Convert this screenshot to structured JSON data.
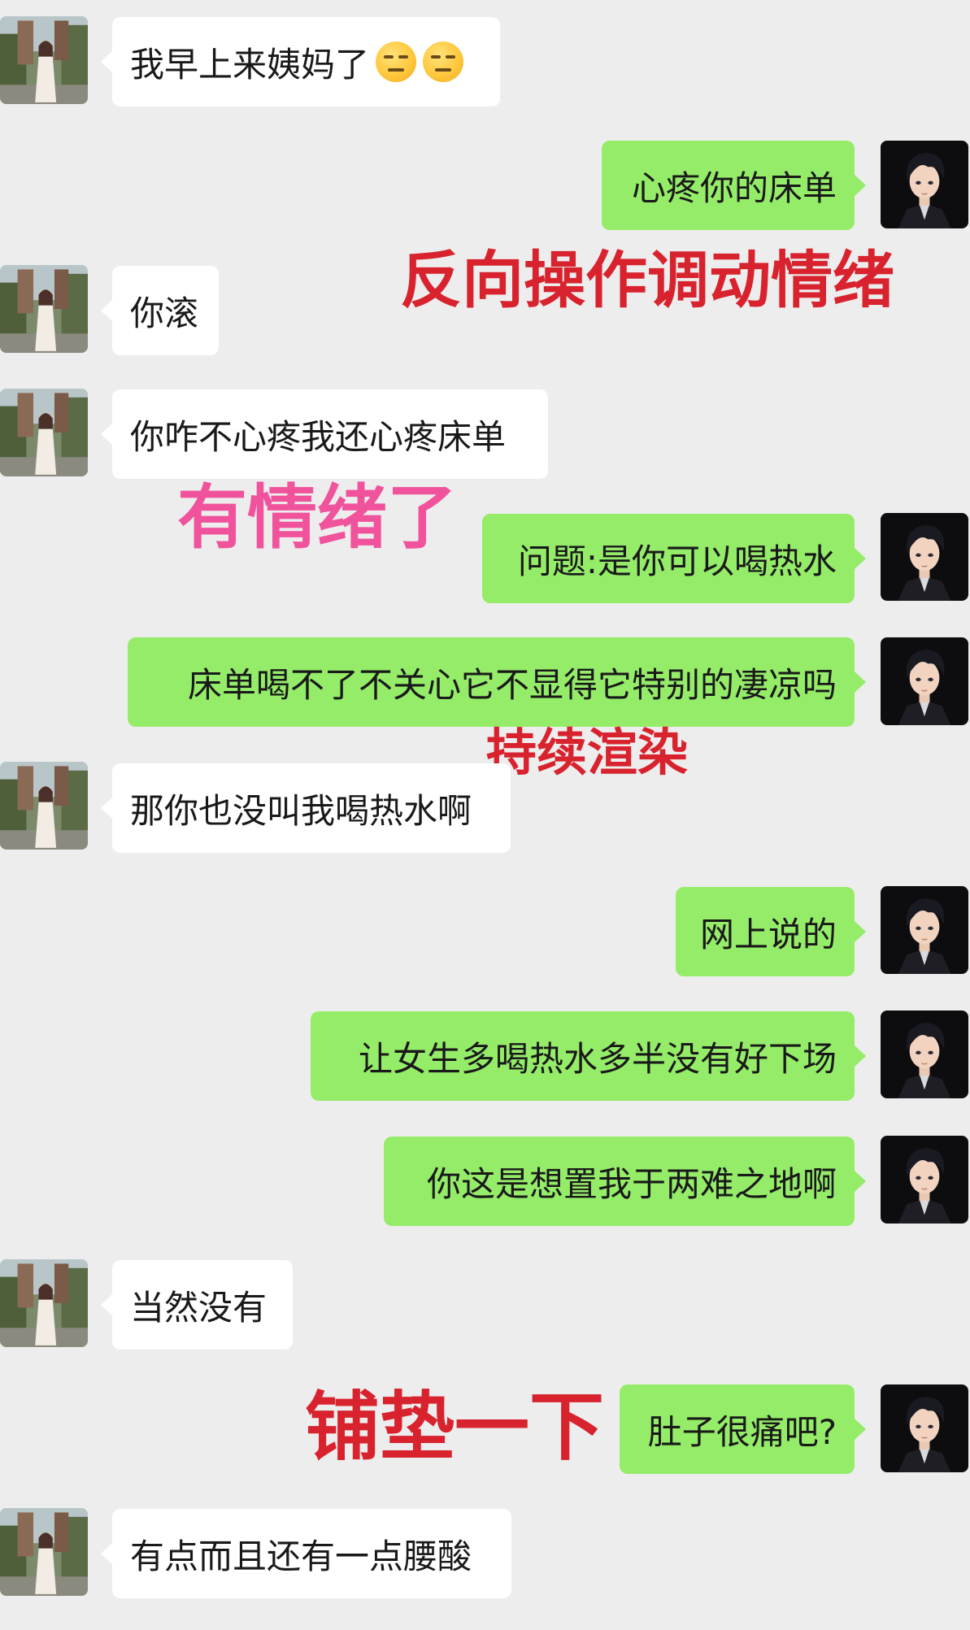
{
  "colors": {
    "background": "#ededed",
    "incoming_bubble": "#ffffff",
    "outgoing_bubble": "#95ec69",
    "annotation_red": "#d8232e",
    "annotation_pink": "#f0539c"
  },
  "avatars": {
    "incoming": "woman-in-garden-photo",
    "outgoing": "anime-dark-haired-man-portrait"
  },
  "messages": [
    {
      "side": "in",
      "text": "我早上来姨妈了",
      "emojis": [
        "expressionless-face-icon",
        "expressionless-face-icon"
      ]
    },
    {
      "side": "out",
      "text": "心疼你的床单"
    },
    {
      "side": "in",
      "text": "你滚"
    },
    {
      "side": "in",
      "text": "你咋不心疼我还心疼床单"
    },
    {
      "side": "out",
      "text": "问题:是你可以喝热水"
    },
    {
      "side": "out",
      "text": "床单喝不了不关心它不显得它特别的凄凉吗"
    },
    {
      "side": "in",
      "text": "那你也没叫我喝热水啊"
    },
    {
      "side": "out",
      "text": "网上说的"
    },
    {
      "side": "out",
      "text": "让女生多喝热水多半没有好下场"
    },
    {
      "side": "out",
      "text": "你这是想置我于两难之地啊"
    },
    {
      "side": "in",
      "text": "当然没有"
    },
    {
      "side": "out",
      "text": "肚子很痛吧?"
    },
    {
      "side": "in",
      "text": "有点而且还有一点腰酸"
    }
  ],
  "annotations": [
    {
      "text": "反向操作调动情绪",
      "color": "red"
    },
    {
      "text": "有情绪了",
      "color": "pink"
    },
    {
      "text": "持续渲染",
      "color": "red"
    },
    {
      "text": "铺垫一下",
      "color": "red"
    }
  ]
}
